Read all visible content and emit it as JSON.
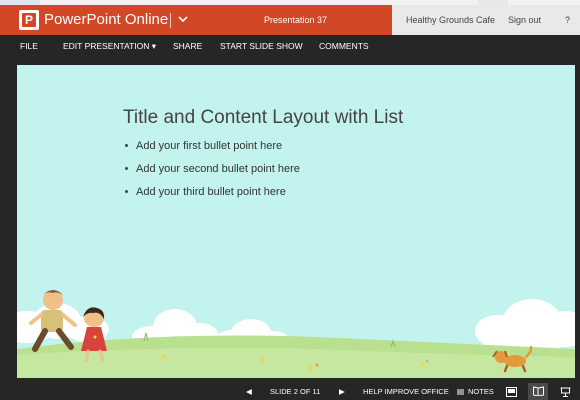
{
  "app": {
    "name": "PowerPoint Online",
    "logo_letter": "P",
    "document_title": "Presentation 37",
    "account_name": "Healthy Grounds Cafe",
    "sign_out": "Sign out",
    "help": "?"
  },
  "menu": {
    "items": [
      {
        "label": "FILE"
      },
      {
        "label": "EDIT PRESENTATION ▾"
      },
      {
        "label": "SHARE"
      },
      {
        "label": "START SLIDE SHOW"
      },
      {
        "label": "COMMENTS"
      }
    ]
  },
  "slide": {
    "title": "Title and Content Layout with List",
    "bullets": [
      "Add your first bullet point here",
      "Add your second bullet point here",
      "Add your third bullet point here"
    ],
    "background_color": "#c3f3ee"
  },
  "status": {
    "prev": "◀",
    "slide_indicator": "SLIDE 2 OF 11",
    "next": "▶",
    "help_improve": "HELP IMPROVE OFFICE",
    "notes_label": "NOTES"
  },
  "colors": {
    "accent": "#d24726",
    "menubar": "#262626",
    "topbar_right": "#e9e9e9"
  }
}
